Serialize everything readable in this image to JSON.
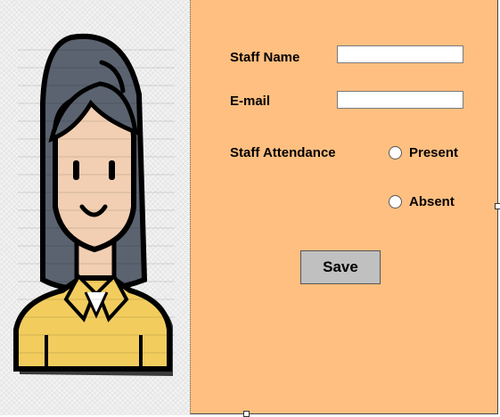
{
  "form": {
    "staff_name_label": "Staff Name",
    "staff_name_value": "",
    "email_label": "E-mail",
    "email_value": "",
    "attendance_label": "Staff Attendance",
    "options": [
      "Present",
      "Absent"
    ],
    "selected_option": "",
    "save_label": "Save"
  },
  "avatar": {
    "icon": "female-staff-avatar-icon"
  },
  "colors": {
    "form_background": "#ffbf80",
    "button_background": "#c0c0c0",
    "hair": "#5b6370",
    "skin": "#f2cfb2",
    "shirt": "#f2cd5e"
  }
}
